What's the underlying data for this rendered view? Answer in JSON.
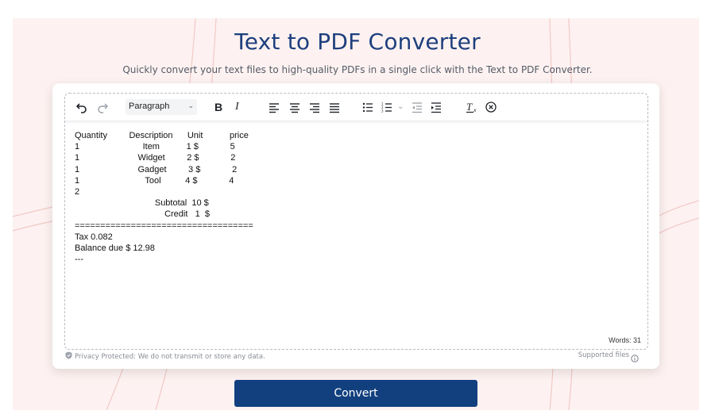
{
  "header": {
    "title": "Text to PDF Converter",
    "subtitle": "Quickly convert your text files to high-quality PDFs in a single click with the Text to PDF Converter."
  },
  "toolbar": {
    "paragraph_select": "Paragraph",
    "bold_label": "B",
    "italic_label": "I",
    "icons": [
      "undo-icon",
      "redo-icon",
      "chevron-down-icon",
      "bold-icon",
      "italic-icon",
      "align-left-icon",
      "align-center-icon",
      "align-right-icon",
      "align-justify-icon",
      "bulleted-list-icon",
      "numbered-list-icon",
      "chevron-down-icon",
      "outdent-icon",
      "indent-icon",
      "clear-formatting-icon",
      "close-circle-icon"
    ]
  },
  "editor": {
    "lines": [
      "Quantity         Description      Unit           price",
      "1                          Item           1 $             5",
      "1                        Widget         2 $             2",
      "1                        Gadget         3 $             2",
      "1                           Tool          4 $             4",
      "2",
      "                                 Subtotal  10 $",
      "                                     Credit   1  $",
      "===================================",
      "Tax 0.082",
      "Balance due $ 12.98",
      "---"
    ],
    "word_count": "Words: 31"
  },
  "footer_notes": {
    "privacy": "Privacy Protected: We do not transmit or store any data.",
    "supported": "Supported files"
  },
  "actions": {
    "convert_label": "Convert"
  },
  "colors": {
    "brand": "#12407f",
    "title": "#1e3f7e",
    "hero_background": "#fdf2f1"
  }
}
